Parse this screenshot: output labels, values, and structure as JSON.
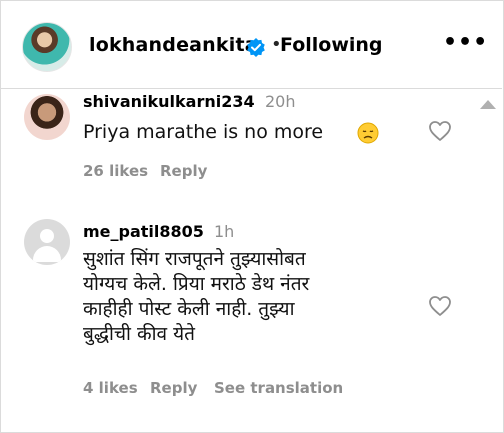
{
  "header": {
    "username": "lokhandeankita",
    "separator": "•",
    "following_label": "Following",
    "more_label": "•••"
  },
  "comments": [
    {
      "username": "shivanikulkarni234",
      "time": "20h",
      "text": "Priya marathe is no more",
      "emoji": "disappointed-face-icon",
      "likes": "26 likes",
      "reply": "Reply"
    },
    {
      "username": "me_patil8805",
      "time": "1h",
      "text_lines": [
        "सुशांत सिंग राजपूतने तुझ्यासोबत",
        "योग्यच केले. प्रिया मराठे डेथ नंतर",
        "काहीही पोस्ट केली नाही. तुझ्या",
        "बुद्धीची कीव येते"
      ],
      "likes": "4 likes",
      "reply": "Reply",
      "see_translation": "See translation"
    }
  ],
  "colors": {
    "verified_blue": "#0095f6",
    "muted_text": "#8e8e8e",
    "border": "#dbdbdb"
  }
}
